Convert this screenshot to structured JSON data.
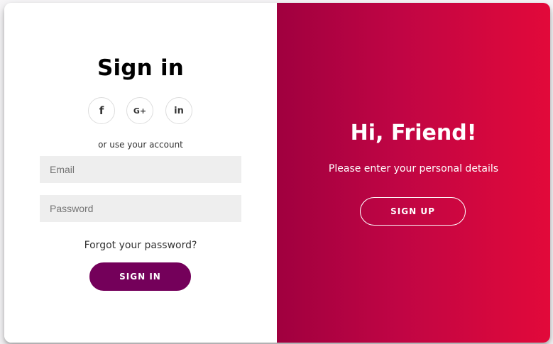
{
  "signin": {
    "title": "Sign in",
    "social": [
      {
        "icon": "facebook-icon",
        "glyph": "f"
      },
      {
        "icon": "google-plus-icon",
        "glyph": "G+"
      },
      {
        "icon": "linkedin-icon",
        "glyph": "in"
      }
    ],
    "hint": "or use your account",
    "email_placeholder": "Email",
    "email_value": "",
    "password_placeholder": "Password",
    "password_value": "",
    "forgot": "Forgot your password?",
    "button": "SIGN IN"
  },
  "overlay": {
    "title": "Hi, Friend!",
    "text": "Please enter your personal details",
    "button": "SIGN UP"
  },
  "colors": {
    "accent": "#74005a",
    "gradient_start": "#a0003f",
    "gradient_end": "#e2093a",
    "field_background": "#eeeeee"
  }
}
